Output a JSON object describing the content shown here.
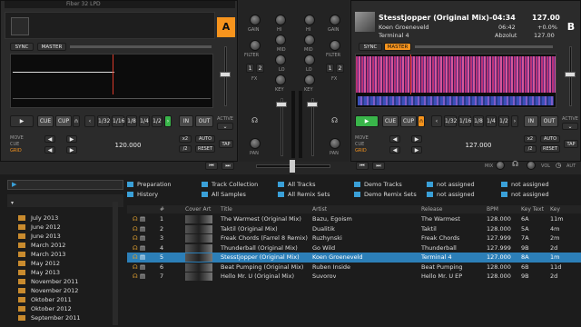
{
  "deck_a": {
    "title": "Fiber 32 LPD",
    "letter": "A",
    "sync": "SYNC",
    "master": "MASTER",
    "cue": "CUE",
    "cup": "CUP",
    "loop_sizes": [
      "1/32",
      "1/16",
      "1/8",
      "1/4",
      "1/2"
    ],
    "in": "IN",
    "out": "OUT",
    "active": "ACTIVE",
    "move": "MOVE",
    "cue_lbl": "CUE",
    "grid": "GRID",
    "tempo": "120.000",
    "auto": "AUTO",
    "x2": "/2",
    "x2b": "x2",
    "reset": "RESET",
    "tap": "TAP"
  },
  "deck_b": {
    "title": "Stesstjopper (Original Mix)",
    "artist": "Koen Groeneveld",
    "album": "Terminal 4",
    "time": "-04:34",
    "elapsed": "06:42",
    "bpm": "127.00",
    "pitch": "+0.0%",
    "key": "Abzolut",
    "key2": "127.00",
    "letter": "B",
    "sync": "SYNC",
    "master": "MASTER",
    "cue": "CUE",
    "cup": "CUP",
    "loop_sizes": [
      "1/32",
      "1/16",
      "1/8",
      "1/4",
      "1/2"
    ],
    "in": "IN",
    "out": "OUT",
    "active": "ACTIVE",
    "move": "MOVE",
    "cue_lbl": "CUE",
    "grid": "GRID",
    "tempo": "127.000",
    "auto": "AUTO",
    "x2": "/2",
    "x2b": "x2",
    "reset": "RESET",
    "tap": "TAP"
  },
  "mixer": {
    "gain": "GAIN",
    "hi": "HI",
    "mid": "MID",
    "lo": "LO",
    "filter": "FILTER",
    "key": "KEY",
    "fx": "FX",
    "pan": "PAN",
    "one": "1",
    "two": "2",
    "mix": "MIX",
    "vol": "VOL",
    "aut": "AUT"
  },
  "browser": {
    "favorites": [
      "Preparation",
      "Track Collection",
      "All Tracks",
      "Demo Tracks",
      "not assigned",
      "History",
      "All Samples",
      "All Remix Sets",
      "Demo Remix Sets",
      "not assigned",
      "not assigned",
      "not assigned"
    ],
    "tree": [
      "July 2013",
      "June 2012",
      "June 2013",
      "March 2012",
      "March 2013",
      "May 2012",
      "May 2013",
      "November 2011",
      "November 2012",
      "Oktober 2011",
      "Oktober 2012",
      "September 2011"
    ],
    "headers": {
      "num": "#",
      "cover": "Cover Art",
      "title": "Title",
      "artist": "Artist",
      "release": "Release",
      "bpm": "BPM",
      "key_text": "Key Text",
      "key": "Key"
    },
    "tracks": [
      {
        "num": "1",
        "title": "The Warmest (Original Mix)",
        "artist": "Bazu, Egoism",
        "release": "The Warmest",
        "bpm": "128.000",
        "key_text": "6A",
        "key": "11m"
      },
      {
        "num": "2",
        "title": "Taktil (Original Mix)",
        "artist": "Dualitik",
        "release": "Taktil",
        "bpm": "128.000",
        "key_text": "5A",
        "key": "4m"
      },
      {
        "num": "3",
        "title": "Freak Chords (Farrel 8 Remix)",
        "artist": "Ruzhynski",
        "release": "Freak Chords",
        "bpm": "127.999",
        "key_text": "7A",
        "key": "2m"
      },
      {
        "num": "4",
        "title": "Thunderball (Original Mix)",
        "artist": "Go Wild",
        "release": "Thunderball",
        "bpm": "127.999",
        "key_text": "9B",
        "key": "2d"
      },
      {
        "num": "5",
        "title": "Stesstjopper (Original Mix)",
        "artist": "Koen Groeneveld",
        "release": "Terminal 4",
        "bpm": "127.000",
        "key_text": "8A",
        "key": "1m"
      },
      {
        "num": "6",
        "title": "Beat Pumping (Original Mix)",
        "artist": "Ruben Inside",
        "release": "Beat Pumping",
        "bpm": "128.000",
        "key_text": "6B",
        "key": "11d"
      },
      {
        "num": "7",
        "title": "Hello Mr. U (Original Mix)",
        "artist": "Suvorov",
        "release": "Hello Mr. U EP",
        "bpm": "128.000",
        "key_text": "9B",
        "key": "2d"
      }
    ]
  }
}
